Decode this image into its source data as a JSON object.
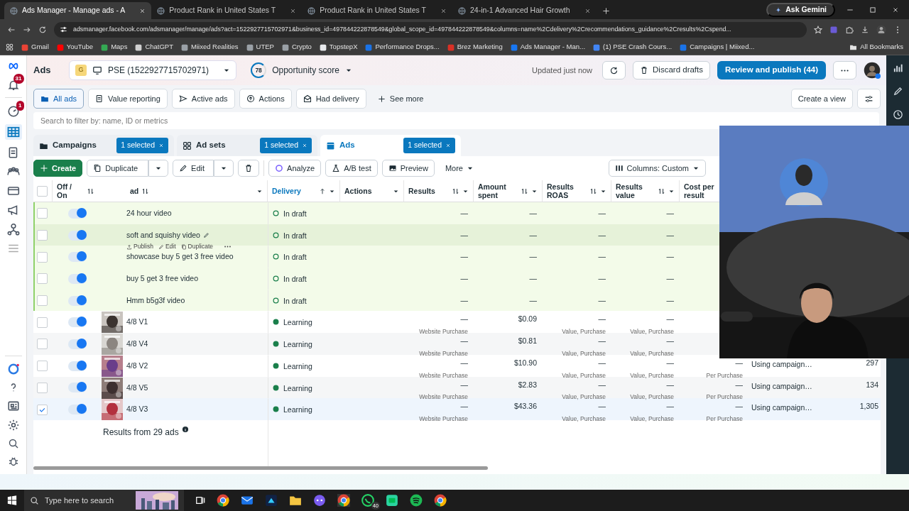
{
  "browser": {
    "tabs": [
      {
        "title": "Ads Manager - Manage ads - A",
        "selected": true
      },
      {
        "title": "Product Rank in United States T",
        "selected": false
      },
      {
        "title": "Product Rank in United States T",
        "selected": false
      },
      {
        "title": "24-in-1 Advanced Hair Growth",
        "selected": false
      }
    ],
    "gemini": "Ask Gemini",
    "url": "adsmanager.facebook.com/adsmanager/manage/ads?act=1522927715702971&business_id=497844222878549&global_scope_id=497844222878549&columns=name%2Cdelivery%2Crecommendations_guidance%2Cresults%2Cspend...",
    "bookmarks": [
      {
        "label": "Gmail",
        "color": "#ea4335"
      },
      {
        "label": "YouTube",
        "color": "#ff0000"
      },
      {
        "label": "Maps",
        "color": "#34a853"
      },
      {
        "label": "ChatGPT",
        "color": "#cfcfcf"
      },
      {
        "label": "Miixed Realities",
        "color": "#9aa0a6"
      },
      {
        "label": "UTEP",
        "color": "#9aa0a6"
      },
      {
        "label": "Crypto",
        "color": "#9aa0a6"
      },
      {
        "label": "TopstepX",
        "color": "#e8eaed"
      },
      {
        "label": "Performance Drops...",
        "color": "#1a73e8"
      },
      {
        "label": "Brez Marketing",
        "color": "#d93025"
      },
      {
        "label": "Ads Manager - Man...",
        "color": "#1877f2"
      },
      {
        "label": "(1) PSE Crash Cours...",
        "color": "#4285f4"
      },
      {
        "label": "Campaigns | Miixed...",
        "color": "#1a73e8"
      }
    ],
    "all_bookmarks": "All Bookmarks"
  },
  "header": {
    "title": "Ads",
    "account_initial": "G",
    "account": "PSE (1522927715702971)",
    "score": "78",
    "score_label": "Opportunity score",
    "updated": "Updated just now",
    "discard": "Discard drafts",
    "publish": "Review and publish (44)"
  },
  "rail_badges": {
    "notifications": "31",
    "alerts": "1"
  },
  "views": [
    {
      "label": "All ads",
      "selected": true
    },
    {
      "label": "Value reporting",
      "selected": false
    },
    {
      "label": "Active ads",
      "selected": false
    },
    {
      "label": "Actions",
      "selected": false
    },
    {
      "label": "Had delivery",
      "selected": false
    }
  ],
  "see_more": "See more",
  "create_view": "Create a view",
  "search": {
    "placeholder": "Search to filter by: name, ID or metrics"
  },
  "levels": [
    {
      "label": "Campaigns",
      "badge": "1 selected",
      "selected": false
    },
    {
      "label": "Ad sets",
      "badge": "1 selected",
      "selected": false
    },
    {
      "label": "Ads",
      "badge": "1 selected",
      "selected": true
    }
  ],
  "toolbar": {
    "create": "Create",
    "duplicate": "Duplicate",
    "edit": "Edit",
    "analyze": "Analyze",
    "ab_test": "A/B test",
    "preview": "Preview",
    "more": "More",
    "columns": "Columns: Custom"
  },
  "table": {
    "columns": [
      {
        "label": "Off / On",
        "sortable": true,
        "sorted": false,
        "menu": false
      },
      {
        "label": "ad",
        "sortable": true,
        "sorted": false,
        "menu": true
      },
      {
        "label": "Delivery",
        "sortable": true,
        "sorted": true,
        "menu": true
      },
      {
        "label": "Actions",
        "sortable": false,
        "sorted": false,
        "menu": true
      },
      {
        "label": "Results",
        "sortable": true,
        "sorted": false,
        "menu": true
      },
      {
        "label": "Amount spent",
        "sortable": true,
        "sorted": false,
        "menu": true
      },
      {
        "label": "Results ROAS",
        "sortable": true,
        "sorted": false,
        "menu": true
      },
      {
        "label": "Results value",
        "sortable": true,
        "sorted": false,
        "menu": true
      },
      {
        "label": "Cost per result",
        "sortable": false,
        "sorted": false,
        "menu": false
      }
    ],
    "all_checked": false,
    "rows": [
      {
        "kind": "draft",
        "name": "24 hour video",
        "checked": false,
        "on": true,
        "hovered": false,
        "delivery": "In draft",
        "results": "—",
        "amount": "—",
        "roas": "—",
        "value": "—"
      },
      {
        "kind": "draft",
        "name": "soft and squishy video",
        "checked": false,
        "on": true,
        "hovered": true,
        "actions": [
          "Publish",
          "Edit",
          "Duplicate"
        ],
        "delivery": "In draft",
        "results": "—",
        "amount": "—",
        "roas": "—",
        "value": "—"
      },
      {
        "kind": "draft",
        "name": "showcase buy 5 get 3 free video",
        "checked": false,
        "on": true,
        "hovered": false,
        "delivery": "In draft",
        "results": "—",
        "amount": "—",
        "roas": "—",
        "value": "—"
      },
      {
        "kind": "draft",
        "name": "buy 5 get 3 free video",
        "checked": false,
        "on": true,
        "hovered": false,
        "delivery": "In draft",
        "results": "—",
        "amount": "—",
        "roas": "—",
        "value": "—"
      },
      {
        "kind": "draft",
        "name": "Hmm b5g3f video",
        "checked": false,
        "on": true,
        "hovered": false,
        "delivery": "In draft",
        "results": "—",
        "amount": "—",
        "roas": "—",
        "value": "—"
      },
      {
        "kind": "published",
        "name": "4/8 V1",
        "checked": false,
        "on": true,
        "hovered": false,
        "delivery": "Learning",
        "results": "—",
        "results_sub": "Website Purchase",
        "amount": "$0.09",
        "roas": "—",
        "roas_sub": "Value, Purchase",
        "value": "—",
        "value_sub": "Value, Purchase"
      },
      {
        "kind": "published",
        "name": "4/8 V4",
        "checked": false,
        "on": true,
        "hovered": false,
        "delivery": "Learning",
        "results": "—",
        "results_sub": "Website Purchase",
        "amount": "$0.81",
        "roas": "—",
        "roas_sub": "Value, Purchase",
        "value": "—",
        "value_sub": "Value, Purchase"
      },
      {
        "kind": "published",
        "name": "4/8 V2",
        "checked": false,
        "on": true,
        "hovered": false,
        "delivery": "Learning",
        "results": "—",
        "results_sub": "Website Purchase",
        "amount": "$10.90",
        "roas": "—",
        "roas_sub": "Value, Purchase",
        "value": "—",
        "value_sub": "Value, Purchase",
        "cost": "—",
        "cost_sub": "Per Purchase",
        "bid": "Using campaign…",
        "budget": "297"
      },
      {
        "kind": "published",
        "name": "4/8 V5",
        "checked": false,
        "on": true,
        "hovered": false,
        "delivery": "Learning",
        "results": "—",
        "results_sub": "Website Purchase",
        "amount": "$2.83",
        "roas": "—",
        "roas_sub": "Value, Purchase",
        "value": "—",
        "value_sub": "Value, Purchase",
        "cost": "—",
        "cost_sub": "Per Purchase",
        "bid": "Using campaign…",
        "budget": "134"
      },
      {
        "kind": "published",
        "name": "4/8 V3",
        "checked": true,
        "on": true,
        "hovered": false,
        "delivery": "Learning",
        "results": "—",
        "results_sub": "Website Purchase",
        "amount": "$43.36",
        "roas": "—",
        "roas_sub": "Value, Purchase",
        "value": "—",
        "value_sub": "Value, Purchase",
        "cost": "—",
        "cost_sub": "Per Purchase",
        "bid": "Using campaign…",
        "budget": "1,305"
      }
    ],
    "footer": "Results from 29 ads"
  },
  "taskbar": {
    "search": "Type here to search",
    "chat_badge": "40"
  }
}
